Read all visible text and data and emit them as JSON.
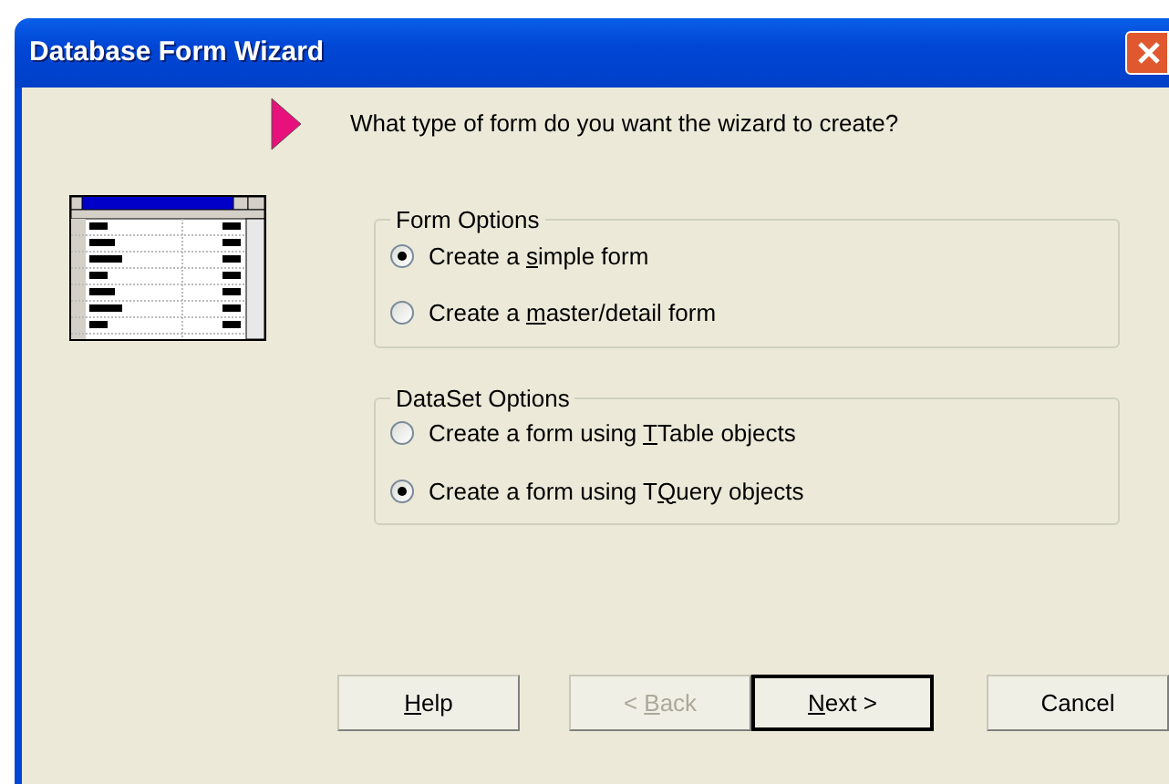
{
  "window": {
    "title": "Database Form Wizard"
  },
  "question": "What type of form do you want the wizard to create?",
  "groups": [
    {
      "title": "Form Options",
      "options": [
        {
          "label": {
            "before": "Create a ",
            "key": "s",
            "after": "imple form"
          },
          "selected": true
        },
        {
          "label": {
            "before": "Create a ",
            "key": "m",
            "after": "aster/detail form"
          },
          "selected": false
        }
      ]
    },
    {
      "title": "DataSet Options",
      "options": [
        {
          "label": {
            "before": "Create a form using ",
            "key": "T",
            "after": "Table objects"
          },
          "selected": false
        },
        {
          "label": {
            "before": "Create a form using T",
            "key": "Q",
            "after": "uery objects"
          },
          "selected": true
        }
      ]
    }
  ],
  "buttons": [
    {
      "label": {
        "key": "H",
        "after": "elp"
      },
      "disabled": false,
      "default": false
    },
    {
      "label": {
        "before": "< ",
        "key": "B",
        "after": "ack"
      },
      "disabled": true,
      "default": false
    },
    {
      "label": {
        "key": "N",
        "after": "ext >"
      },
      "disabled": false,
      "default": true
    },
    {
      "label": {
        "before": "Cancel"
      },
      "disabled": false,
      "default": false
    }
  ]
}
